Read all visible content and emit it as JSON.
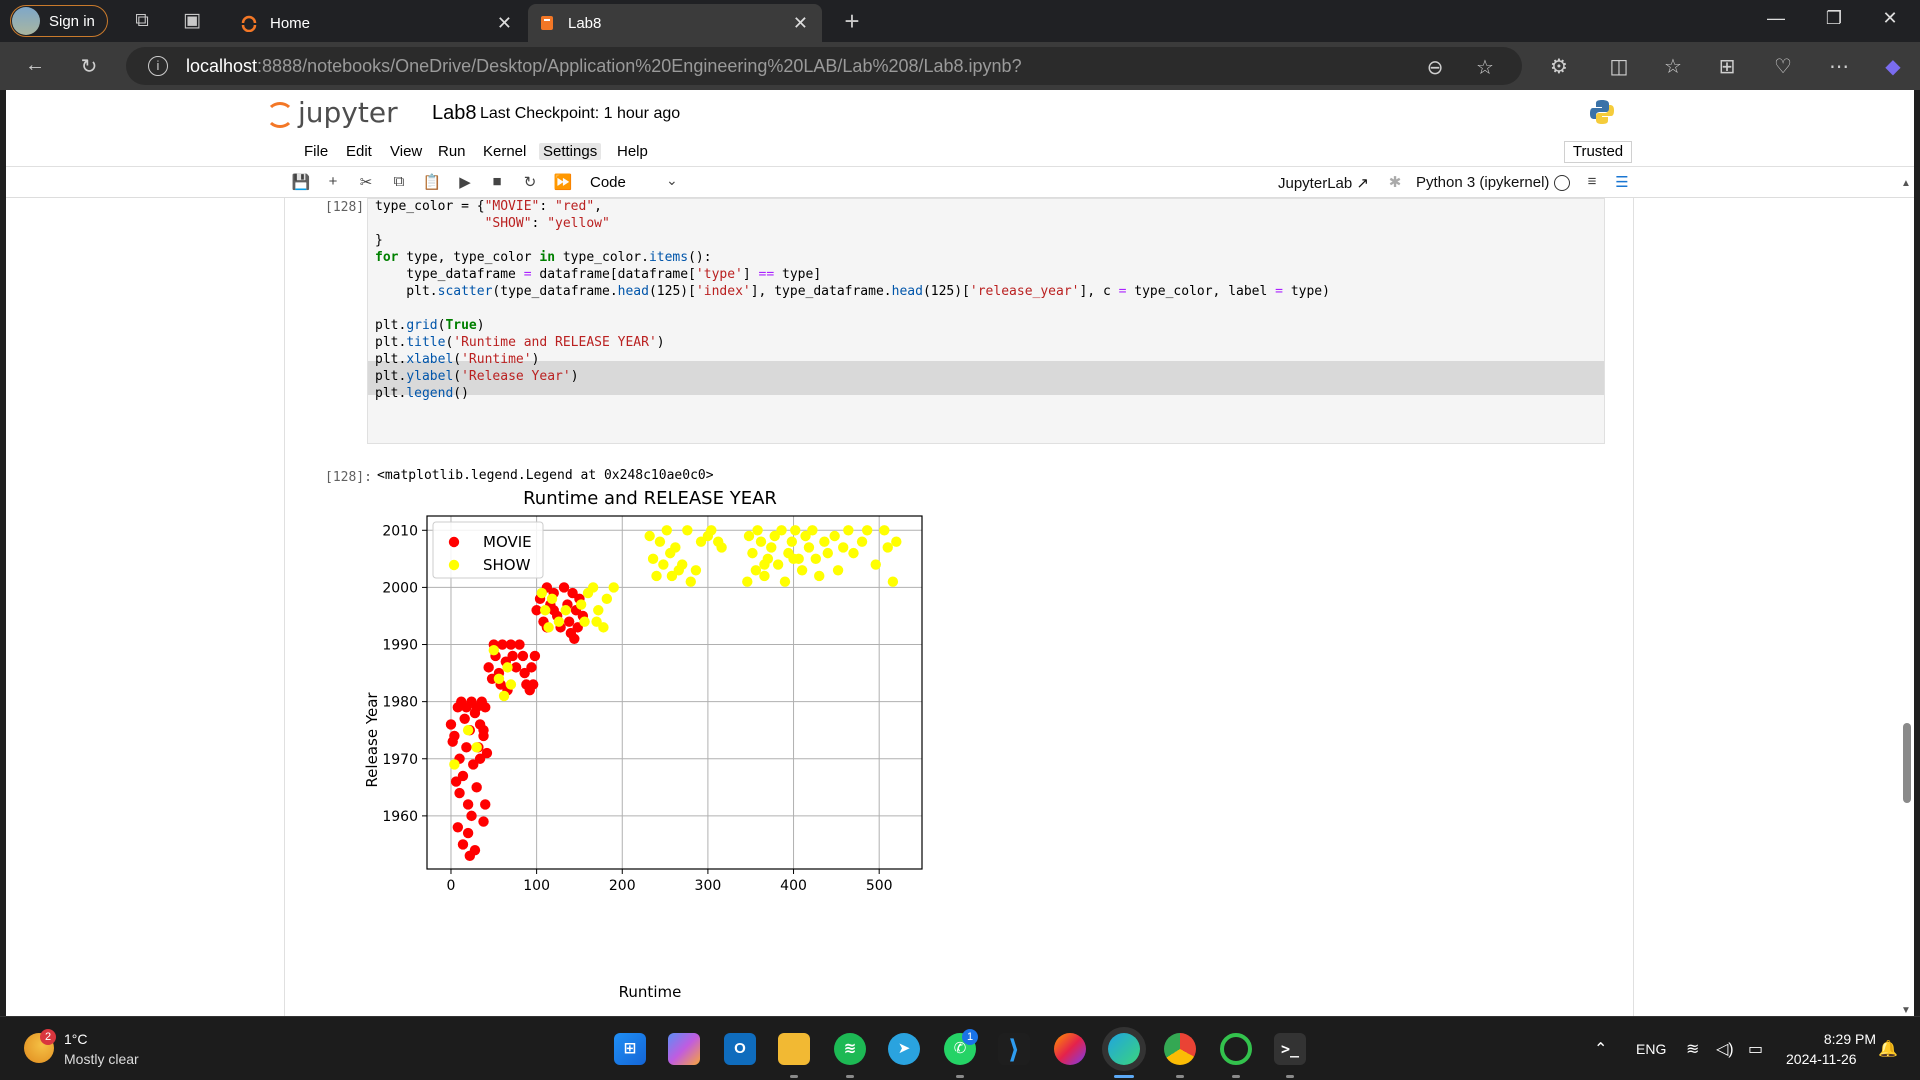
{
  "browser": {
    "signin_label": "Sign in",
    "tabs": [
      {
        "title": "Home"
      },
      {
        "title": "Lab8"
      }
    ],
    "url_host": "localhost",
    "url_rest": ":8888/notebooks/OneDrive/Desktop/Application%20Engineering%20LAB/Lab%208/Lab8.ipynb?"
  },
  "jupyter": {
    "logo_text": "jupyter",
    "notebook_title": "Lab8",
    "checkpoint": "Last Checkpoint: 1 hour ago",
    "menu": [
      "File",
      "Edit",
      "View",
      "Run",
      "Kernel",
      "Settings",
      "Help"
    ],
    "trusted": "Trusted",
    "cell_type": "Code",
    "jupyterlab_link": "JupyterLab",
    "kernel": "Python 3 (ipykernel)"
  },
  "cell": {
    "in_prompt": "[128]:",
    "out_prompt": "[128]:",
    "output_text": "<matplotlib.legend.Legend at 0x248c10ae0c0>"
  },
  "chart_data": {
    "type": "scatter",
    "title": "Runtime and RELEASE YEAR",
    "xlabel": "Runtime",
    "ylabel": "Release Year",
    "xlim": [
      -28,
      550
    ],
    "ylim": [
      1950.7,
      2012.5
    ],
    "xticks": [
      0,
      100,
      200,
      300,
      400,
      500
    ],
    "yticks": [
      1960,
      1970,
      1980,
      1990,
      2000,
      2010
    ],
    "grid": true,
    "legend_position": "top-left",
    "series": [
      {
        "name": "MOVIE",
        "color": "#ff0000",
        "points": [
          [
            0,
            1976
          ],
          [
            2,
            1973
          ],
          [
            8,
            1979
          ],
          [
            12,
            1980
          ],
          [
            18,
            1979
          ],
          [
            24,
            1980
          ],
          [
            30,
            1979
          ],
          [
            36,
            1980
          ],
          [
            40,
            1979
          ],
          [
            4,
            1974
          ],
          [
            10,
            1970
          ],
          [
            16,
            1977
          ],
          [
            22,
            1975
          ],
          [
            28,
            1978
          ],
          [
            34,
            1976
          ],
          [
            38,
            1974
          ],
          [
            42,
            1971
          ],
          [
            6,
            1966
          ],
          [
            10,
            1964
          ],
          [
            14,
            1967
          ],
          [
            18,
            1972
          ],
          [
            20,
            1962
          ],
          [
            24,
            1960
          ],
          [
            26,
            1969
          ],
          [
            30,
            1965
          ],
          [
            34,
            1970
          ],
          [
            32,
            1972
          ],
          [
            38,
            1975
          ],
          [
            8,
            1958
          ],
          [
            14,
            1955
          ],
          [
            20,
            1957
          ],
          [
            22,
            1953
          ],
          [
            28,
            1954
          ],
          [
            40,
            1962
          ],
          [
            38,
            1959
          ],
          [
            44,
            1986
          ],
          [
            48,
            1984
          ],
          [
            50,
            1990
          ],
          [
            52,
            1988
          ],
          [
            56,
            1985
          ],
          [
            58,
            1983
          ],
          [
            60,
            1990
          ],
          [
            64,
            1987
          ],
          [
            66,
            1982
          ],
          [
            70,
            1990
          ],
          [
            72,
            1988
          ],
          [
            76,
            1986
          ],
          [
            80,
            1990
          ],
          [
            84,
            1988
          ],
          [
            86,
            1985
          ],
          [
            88,
            1983
          ],
          [
            92,
            1982
          ],
          [
            94,
            1986
          ],
          [
            96,
            1983
          ],
          [
            98,
            1988
          ],
          [
            100,
            1996
          ],
          [
            104,
            1998
          ],
          [
            108,
            1994
          ],
          [
            112,
            2000
          ],
          [
            116,
            1997
          ],
          [
            120,
            1999
          ],
          [
            124,
            1995
          ],
          [
            128,
            1993
          ],
          [
            132,
            2000
          ],
          [
            136,
            1997
          ],
          [
            138,
            1994
          ],
          [
            140,
            1992
          ],
          [
            142,
            1999
          ],
          [
            146,
            1996
          ],
          [
            148,
            1993
          ],
          [
            150,
            1998
          ],
          [
            154,
            1995
          ],
          [
            120,
            1996
          ],
          [
            112,
            1993
          ],
          [
            144,
            1991
          ]
        ]
      },
      {
        "name": "SHOW",
        "color": "#ffff00",
        "points": [
          [
            4,
            1969
          ],
          [
            20,
            1975
          ],
          [
            30,
            1972
          ],
          [
            50,
            1989
          ],
          [
            56,
            1984
          ],
          [
            62,
            1981
          ],
          [
            66,
            1986
          ],
          [
            70,
            1983
          ],
          [
            106,
            1999
          ],
          [
            110,
            1996
          ],
          [
            114,
            1993
          ],
          [
            118,
            1998
          ],
          [
            126,
            1994
          ],
          [
            134,
            1996
          ],
          [
            152,
            1997
          ],
          [
            156,
            1994
          ],
          [
            160,
            1999
          ],
          [
            166,
            2000
          ],
          [
            172,
            1996
          ],
          [
            178,
            1993
          ],
          [
            182,
            1998
          ],
          [
            190,
            2000
          ],
          [
            170,
            1994
          ],
          [
            232,
            2009
          ],
          [
            236,
            2005
          ],
          [
            240,
            2002
          ],
          [
            244,
            2008
          ],
          [
            248,
            2004
          ],
          [
            252,
            2010
          ],
          [
            256,
            2006
          ],
          [
            258,
            2002
          ],
          [
            262,
            2007
          ],
          [
            266,
            2003
          ],
          [
            270,
            2004
          ],
          [
            276,
            2010
          ],
          [
            280,
            2001
          ],
          [
            286,
            2003
          ],
          [
            292,
            2008
          ],
          [
            300,
            2009
          ],
          [
            304,
            2010
          ],
          [
            312,
            2008
          ],
          [
            316,
            2007
          ],
          [
            348,
            2009
          ],
          [
            352,
            2006
          ],
          [
            356,
            2003
          ],
          [
            358,
            2010
          ],
          [
            362,
            2008
          ],
          [
            366,
            2002
          ],
          [
            370,
            2005
          ],
          [
            374,
            2007
          ],
          [
            378,
            2009
          ],
          [
            382,
            2004
          ],
          [
            386,
            2010
          ],
          [
            390,
            2001
          ],
          [
            394,
            2006
          ],
          [
            398,
            2008
          ],
          [
            402,
            2010
          ],
          [
            406,
            2005
          ],
          [
            410,
            2003
          ],
          [
            414,
            2009
          ],
          [
            418,
            2007
          ],
          [
            422,
            2010
          ],
          [
            426,
            2005
          ],
          [
            430,
            2002
          ],
          [
            436,
            2008
          ],
          [
            440,
            2006
          ],
          [
            448,
            2009
          ],
          [
            452,
            2003
          ],
          [
            458,
            2007
          ],
          [
            464,
            2010
          ],
          [
            470,
            2006
          ],
          [
            480,
            2008
          ],
          [
            486,
            2010
          ],
          [
            496,
            2004
          ],
          [
            506,
            2010
          ],
          [
            510,
            2007
          ],
          [
            516,
            2001
          ],
          [
            520,
            2008
          ],
          [
            346,
            2001
          ],
          [
            366,
            2004
          ],
          [
            400,
            2005
          ]
        ]
      }
    ]
  },
  "taskbar": {
    "weather_temp": "1°C",
    "weather_desc": "Mostly clear",
    "weather_badge": "2",
    "whatsapp_badge": "1",
    "lang": "ENG",
    "time": "8:29 PM",
    "date": "2024-11-26"
  }
}
